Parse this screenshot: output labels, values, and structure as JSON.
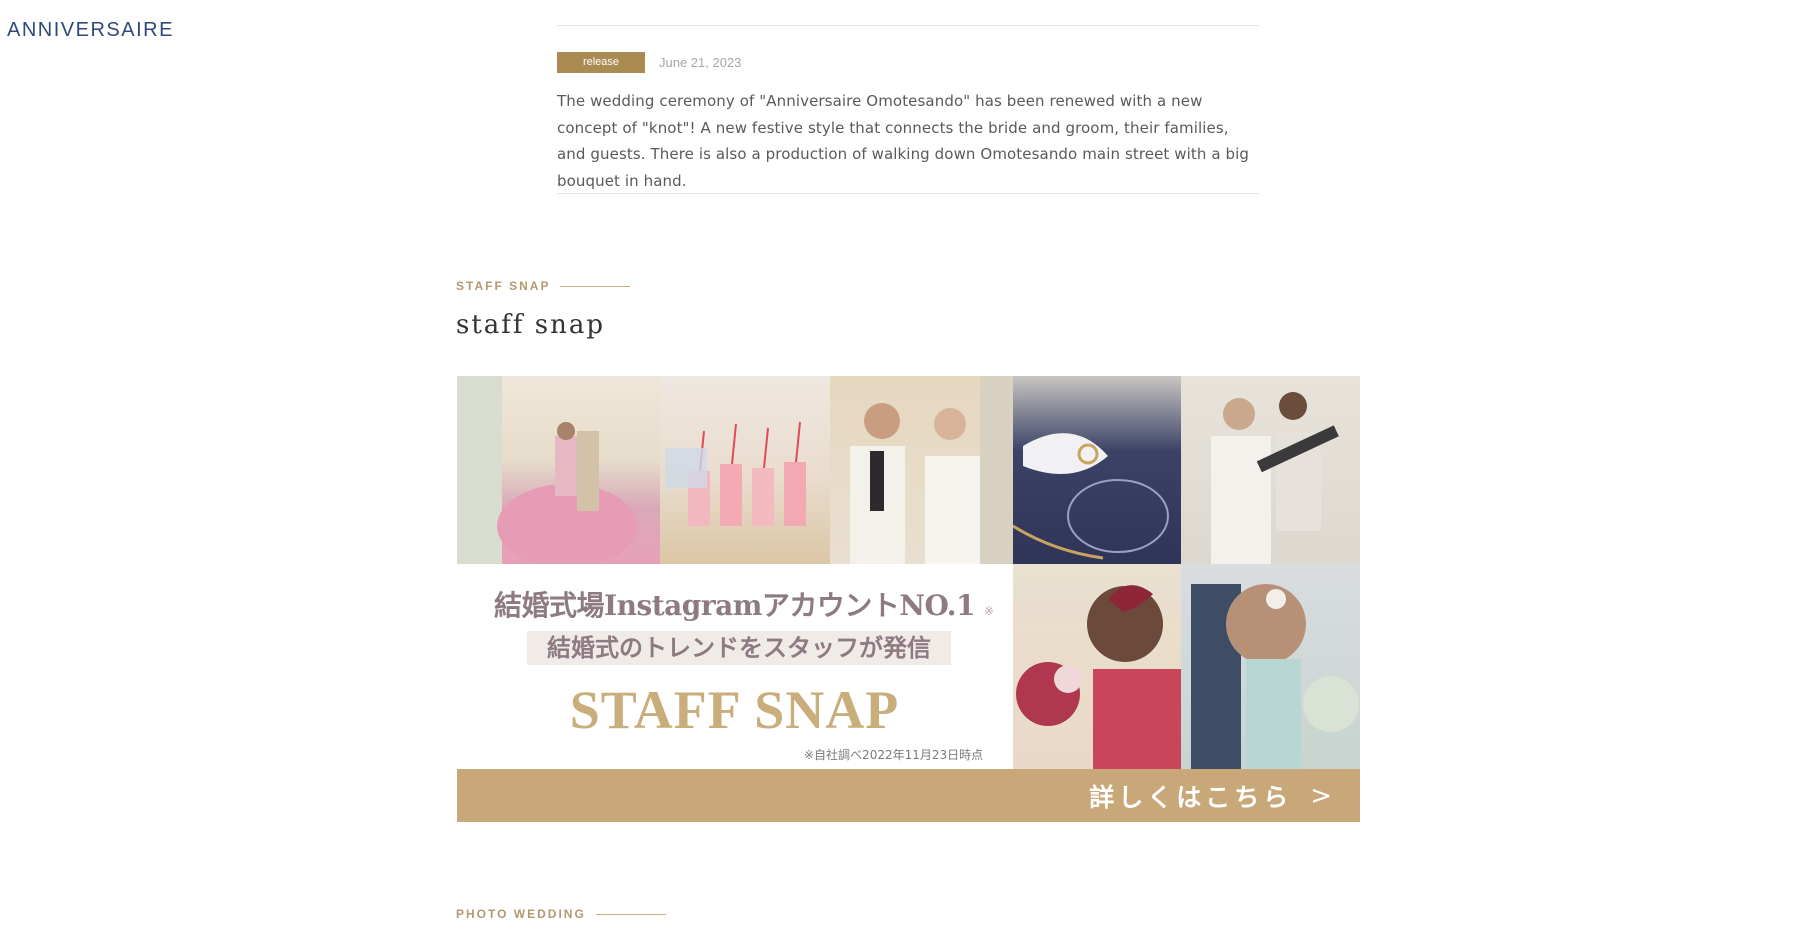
{
  "header": {
    "logo_text": "ANNIVERSAIRE"
  },
  "news": {
    "badge": "release",
    "date": "June 21, 2023",
    "body": "The wedding ceremony of \"Anniversaire Omotesando\" has been renewed with a new concept of \"knot\"! A new festive style that connects the bride and groom, their families, and guests. There is also a production of walking down Omotesando main street with a big bouquet in hand."
  },
  "staff_snap": {
    "label": "STAFF SNAP",
    "title": "staff snap",
    "banner": {
      "line1": "結婚式場InstagramアカウントNO.1",
      "line1_note": "※",
      "line2": "結婚式のトレンドをスタッフが発信",
      "line3": "STAFF SNAP",
      "survey_note": "※自社調べ2022年11月23日時点",
      "cta": "詳しくはこちら",
      "cta_arrow": ">"
    }
  },
  "photo_wedding": {
    "label": "PHOTO WEDDING"
  },
  "colors": {
    "accent_gold": "#a98b53",
    "cta_gold": "#c8a878",
    "logo_navy": "#2f4a7a"
  }
}
